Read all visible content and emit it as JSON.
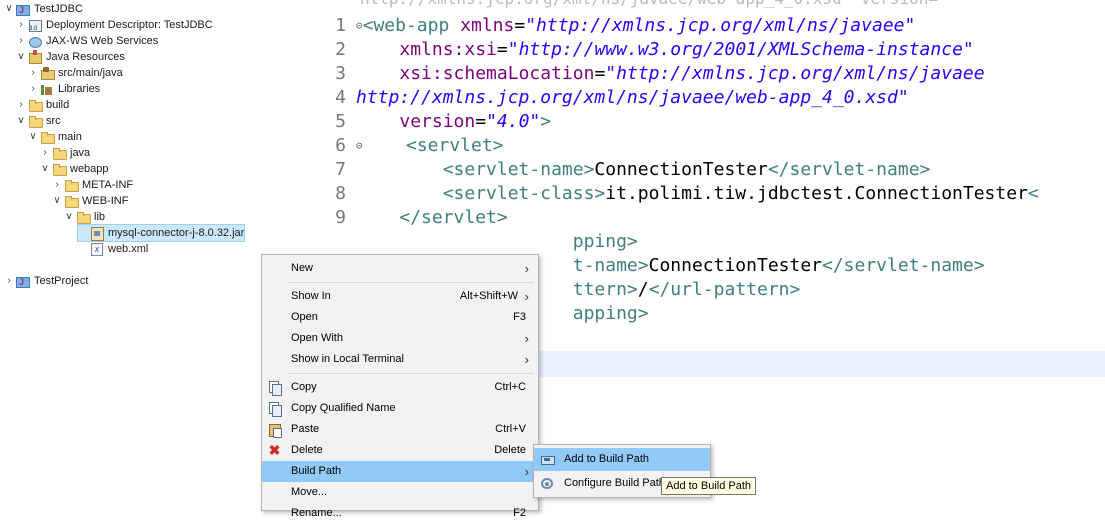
{
  "explorer": {
    "nodes": [
      {
        "label": "TestJDBC",
        "twisty": "expanded",
        "icon": "project-icon"
      },
      {
        "label": "Deployment Descriptor: TestJDBC",
        "twisty": "collapsed",
        "icon": "deployment-descriptor-icon"
      },
      {
        "label": "JAX-WS Web Services",
        "twisty": "collapsed",
        "icon": "web-services-icon"
      },
      {
        "label": "Java Resources",
        "twisty": "expanded",
        "icon": "java-resources-icon"
      },
      {
        "label": "src/main/java",
        "twisty": "collapsed",
        "icon": "source-folder-icon"
      },
      {
        "label": "Libraries",
        "twisty": "collapsed",
        "icon": "libraries-icon"
      },
      {
        "label": "build",
        "twisty": "collapsed",
        "icon": "folder-icon"
      },
      {
        "label": "src",
        "twisty": "expanded",
        "icon": "folder-icon"
      },
      {
        "label": "main",
        "twisty": "expanded",
        "icon": "folder-icon"
      },
      {
        "label": "java",
        "twisty": "collapsed",
        "icon": "folder-icon"
      },
      {
        "label": "webapp",
        "twisty": "expanded",
        "icon": "folder-icon"
      },
      {
        "label": "META-INF",
        "twisty": "collapsed",
        "icon": "folder-icon"
      },
      {
        "label": "WEB-INF",
        "twisty": "expanded",
        "icon": "folder-icon"
      },
      {
        "label": "lib",
        "twisty": "expanded",
        "icon": "folder-icon"
      },
      {
        "label": "mysql-connector-j-8.0.32.jar",
        "twisty": "none",
        "icon": "jar-icon",
        "selected": true
      },
      {
        "label": "web.xml",
        "twisty": "none",
        "icon": "xml-file-icon"
      },
      {
        "label": "TestProject",
        "twisty": "collapsed",
        "icon": "project-icon"
      }
    ]
  },
  "editor": {
    "partial_top_line": "http://xmlns.jcp.org/xml/ns/javaee/web-app_4_0.xsd\" version=",
    "lines": [
      {
        "num": "1",
        "fold": "⊝",
        "parts": [
          [
            "tag",
            "<web-app "
          ],
          [
            "att",
            "xmlns"
          ],
          [
            "eq",
            "="
          ],
          [
            "val",
            "\"http://xmlns.jcp.org/xml/ns/javaee\""
          ]
        ]
      },
      {
        "num": "2",
        "fold": "",
        "parts": [
          [
            "tx",
            "    "
          ],
          [
            "att",
            "xmlns:xsi"
          ],
          [
            "eq",
            "="
          ],
          [
            "val",
            "\"http://www.w3.org/2001/XMLSchema-instance\""
          ]
        ]
      },
      {
        "num": "3",
        "fold": "",
        "parts": [
          [
            "tx",
            "    "
          ],
          [
            "att",
            "xsi:schemaLocation"
          ],
          [
            "eq",
            "="
          ],
          [
            "val",
            "\"http://xmlns.jcp.org/xml/ns/javaee"
          ]
        ]
      },
      {
        "num": "4",
        "fold": "",
        "parts": [
          [
            "val",
            "http://xmlns.jcp.org/xml/ns/javaee/web-app_4_0.xsd\""
          ]
        ]
      },
      {
        "num": "5",
        "fold": "",
        "parts": [
          [
            "tx",
            "    "
          ],
          [
            "att",
            "version"
          ],
          [
            "eq",
            "="
          ],
          [
            "val",
            "\"4.0\""
          ],
          [
            "tag",
            ">"
          ]
        ]
      },
      {
        "num": "6",
        "fold": "⊝",
        "parts": [
          [
            "tx",
            "    "
          ],
          [
            "tag",
            "<servlet>"
          ]
        ]
      },
      {
        "num": "7",
        "fold": "",
        "parts": [
          [
            "tx",
            "        "
          ],
          [
            "tag",
            "<servlet-name>"
          ],
          [
            "tx",
            "ConnectionTester"
          ],
          [
            "tag",
            "</servlet-name>"
          ]
        ]
      },
      {
        "num": "8",
        "fold": "",
        "parts": [
          [
            "tx",
            "        "
          ],
          [
            "tag",
            "<servlet-class>"
          ],
          [
            "tx",
            "it.polimi.tiw.jdbctest.ConnectionTester"
          ],
          [
            "tag",
            "<"
          ]
        ]
      },
      {
        "num": "9",
        "fold": "",
        "parts": [
          [
            "tx",
            "    "
          ],
          [
            "tag",
            "</servlet>"
          ]
        ]
      },
      {
        "num": "",
        "fold": "",
        "parts": [
          [
            "tx",
            "                    "
          ],
          [
            "tag",
            "pping>"
          ]
        ]
      },
      {
        "num": "",
        "fold": "",
        "parts": [
          [
            "tx",
            "                    "
          ],
          [
            "tag",
            "t-name>"
          ],
          [
            "tx",
            "ConnectionTester"
          ],
          [
            "tag",
            "</servlet-name>"
          ]
        ]
      },
      {
        "num": "",
        "fold": "",
        "parts": [
          [
            "tx",
            "                    "
          ],
          [
            "tag",
            "ttern>"
          ],
          [
            "tx",
            "/"
          ],
          [
            "tag",
            "</url-pattern>"
          ]
        ]
      },
      {
        "num": "",
        "fold": "",
        "parts": [
          [
            "tx",
            "                    "
          ],
          [
            "tag",
            "apping>"
          ]
        ]
      }
    ]
  },
  "context_menu": {
    "items": [
      {
        "type": "item",
        "label": "New",
        "shortcut": "",
        "submenu": true,
        "icon": ""
      },
      {
        "type": "sep"
      },
      {
        "type": "item",
        "label": "Show In",
        "shortcut": "Alt+Shift+W",
        "submenu": true,
        "icon": ""
      },
      {
        "type": "item",
        "label": "Open",
        "shortcut": "F3",
        "submenu": false,
        "icon": ""
      },
      {
        "type": "item",
        "label": "Open With",
        "shortcut": "",
        "submenu": true,
        "icon": ""
      },
      {
        "type": "item",
        "label": "Show in Local Terminal",
        "shortcut": "",
        "submenu": true,
        "icon": ""
      },
      {
        "type": "sep"
      },
      {
        "type": "item",
        "label": "Copy",
        "shortcut": "Ctrl+C",
        "submenu": false,
        "icon": "copy-icon"
      },
      {
        "type": "item",
        "label": "Copy Qualified Name",
        "shortcut": "",
        "submenu": false,
        "icon": "copy-qualified-name-icon"
      },
      {
        "type": "item",
        "label": "Paste",
        "shortcut": "Ctrl+V",
        "submenu": false,
        "icon": "paste-icon"
      },
      {
        "type": "item",
        "label": "Delete",
        "shortcut": "Delete",
        "submenu": false,
        "icon": "delete-icon"
      },
      {
        "type": "item",
        "label": "Build Path",
        "shortcut": "",
        "submenu": true,
        "icon": "",
        "active": true
      },
      {
        "type": "item",
        "label": "Move...",
        "shortcut": "",
        "submenu": false,
        "icon": ""
      },
      {
        "type": "item",
        "label": "Rename...",
        "shortcut": "F2",
        "submenu": false,
        "icon": ""
      }
    ]
  },
  "build_path_submenu": {
    "items": [
      {
        "label": "Add to Build Path",
        "icon": "add-to-build-path-icon",
        "active": true
      },
      {
        "label": "Configure Build Path...",
        "icon": "configure-build-path-icon",
        "active": false
      }
    ]
  },
  "tooltip": {
    "text": "Add to Build Path"
  },
  "colors": {
    "selection": "#cce8ff",
    "menu_highlight": "#91c9f7",
    "xml_tag": "#3f7f7f",
    "xml_attribute": "#7f007f",
    "xml_value": "#2a00ff",
    "current_line": "#e8f2fe"
  }
}
